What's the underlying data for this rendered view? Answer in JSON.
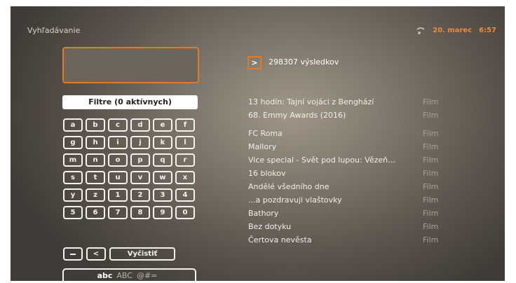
{
  "header": {
    "title": "Vyhľadávanie",
    "date": "20. marec",
    "time": "6:57",
    "wifi_icon": "wifi-icon",
    "accent": "#e07b2c"
  },
  "search": {
    "value": ""
  },
  "filter": {
    "label": "Filtre (0 aktívnych)"
  },
  "keyboard": {
    "keys": [
      "a",
      "b",
      "c",
      "d",
      "e",
      "f",
      "g",
      "h",
      "i",
      "j",
      "k",
      "l",
      "m",
      "n",
      "o",
      "p",
      "q",
      "r",
      "s",
      "t",
      "u",
      "v",
      "w",
      "x",
      "y",
      "z",
      "1",
      "2",
      "3",
      "4",
      "5",
      "6",
      "7",
      "8",
      "9",
      "0"
    ],
    "space_label": "−",
    "back_label": "<",
    "clear_label": "Vyčistiť",
    "modes": [
      "abc",
      "ABC",
      "@#="
    ]
  },
  "results": {
    "count_label": "298307 výsledkov",
    "items": [
      {
        "title": "13 hodín: Tajní vojáci z Benghází",
        "type": "Film"
      },
      {
        "title": "68. Emmy Awards (2016)",
        "type": "Film"
      },
      {
        "title": "FC Roma",
        "type": "Film"
      },
      {
        "title": "Mallory",
        "type": "Film"
      },
      {
        "title": "Vice special - Svět pod lupou: Vězeň…",
        "type": "Film"
      },
      {
        "title": "16 blokov",
        "type": "Film"
      },
      {
        "title": "Andělé všedního dne",
        "type": "Film"
      },
      {
        "title": "...a pozdravuji vlaštovky",
        "type": "Film"
      },
      {
        "title": "Bathory",
        "type": "Film"
      },
      {
        "title": "Bez dotyku",
        "type": "Film"
      },
      {
        "title": "Čertova nevěsta",
        "type": "Film"
      }
    ]
  }
}
